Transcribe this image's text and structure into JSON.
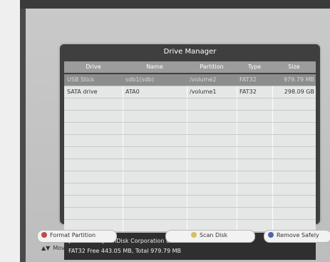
{
  "dialog": {
    "title": "Drive Manager",
    "columns": [
      "Drive",
      "Name",
      "Partition",
      "Type",
      "Size"
    ],
    "rows": [
      {
        "drive": "USB Stick",
        "name": "sdb1(sdb)",
        "partition": "/volume2",
        "type": "FAT32",
        "size": "979.79 MB",
        "selected": true
      },
      {
        "drive": "SATA drive",
        "name": "ATA0",
        "partition": "/volume1",
        "type": "FAT32",
        "size": "298.09 GB",
        "selected": false
      }
    ],
    "info": {
      "line1": "[ USB Stick ] SanDisk Corporation U3 Cruzer Micro",
      "line2": "FAT32  Free 443.05 MB, Total 979.79 MB"
    }
  },
  "legend": {
    "format_partition": "Format Partition",
    "move": "Move",
    "scan_disk": "Scan Disk",
    "remove_safely": "Remove Safely"
  },
  "colors": {
    "red": "#c04a4a",
    "yellow": "#d2c060",
    "blue": "#4e66a5"
  }
}
